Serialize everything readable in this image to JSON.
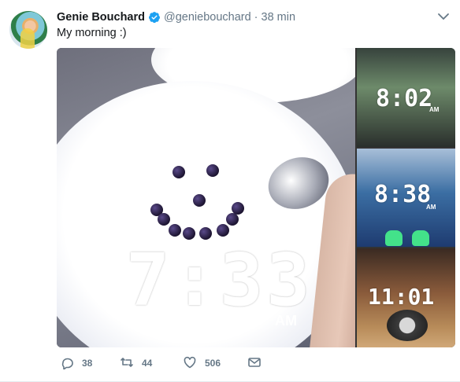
{
  "tweet": {
    "author_name": "Genie Bouchard",
    "handle": "@geniebouchard",
    "separator": "·",
    "time": "38 min",
    "text": "My morning :)"
  },
  "media": {
    "main_clock": "7:33",
    "main_ampm": "AM",
    "thumbs": [
      {
        "clock": "8:02",
        "ampm": "AM"
      },
      {
        "clock": "8:38",
        "ampm": "AM"
      },
      {
        "clock": "11:01",
        "ampm": ""
      }
    ]
  },
  "actions": {
    "reply_count": "38",
    "retweet_count": "44",
    "like_count": "506"
  },
  "colors": {
    "verified": "#1da1f2",
    "muted": "#657786",
    "text": "#14171a"
  },
  "icons": [
    "verified-badge-icon",
    "chevron-down-icon",
    "reply-icon",
    "retweet-icon",
    "like-icon",
    "direct-message-icon"
  ]
}
